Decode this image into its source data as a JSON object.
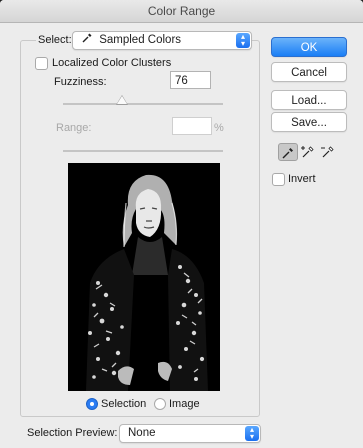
{
  "dialog": {
    "title": "Color Range"
  },
  "select": {
    "label": "Select:",
    "value": "Sampled Colors",
    "icon": "eyedropper-icon"
  },
  "localized": {
    "label": "Localized Color Clusters",
    "checked": false
  },
  "fuzziness": {
    "label": "Fuzziness:",
    "value": "76"
  },
  "range": {
    "label": "Range:",
    "value": "",
    "unit": "%"
  },
  "buttons": {
    "ok": "OK",
    "cancel": "Cancel",
    "load": "Load...",
    "save": "Save..."
  },
  "tools": [
    "eyedropper-icon",
    "eyedropper-plus-icon",
    "eyedropper-minus-icon"
  ],
  "invert": {
    "label": "Invert",
    "checked": false
  },
  "view": {
    "selection": "Selection",
    "image": "Image",
    "selected": "selection"
  },
  "selection_preview": {
    "label": "Selection Preview:",
    "value": "None"
  }
}
